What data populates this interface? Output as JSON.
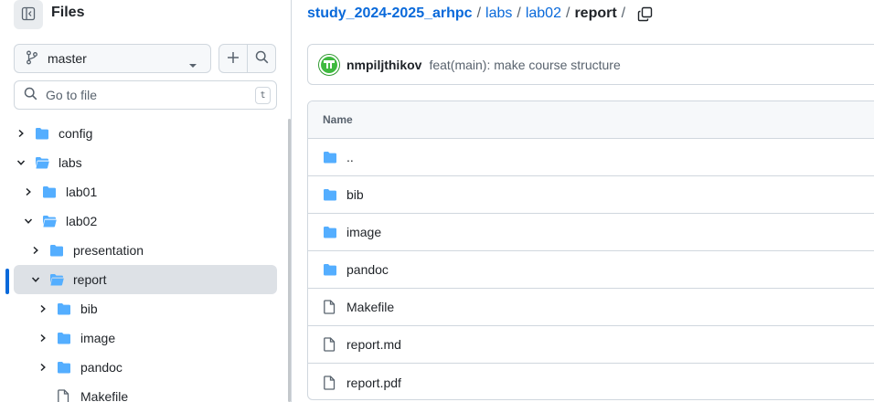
{
  "sidebar": {
    "title": "Files",
    "branch": "master",
    "goto_placeholder": "Go to file",
    "goto_shortcut": "t",
    "tree": [
      {
        "label": "config",
        "type": "folder",
        "expanded": false,
        "depth": 0
      },
      {
        "label": "labs",
        "type": "folder",
        "expanded": true,
        "depth": 0
      },
      {
        "label": "lab01",
        "type": "folder",
        "expanded": false,
        "depth": 1
      },
      {
        "label": "lab02",
        "type": "folder",
        "expanded": true,
        "depth": 1
      },
      {
        "label": "presentation",
        "type": "folder",
        "expanded": false,
        "depth": 2
      },
      {
        "label": "report",
        "type": "folder",
        "expanded": true,
        "depth": 2,
        "active": true
      },
      {
        "label": "bib",
        "type": "folder",
        "expanded": false,
        "depth": 3
      },
      {
        "label": "image",
        "type": "folder",
        "expanded": false,
        "depth": 3
      },
      {
        "label": "pandoc",
        "type": "folder",
        "expanded": false,
        "depth": 3
      },
      {
        "label": "Makefile",
        "type": "file",
        "depth": 3
      }
    ]
  },
  "breadcrumb": {
    "repo": "study_2024-2025_arhpc",
    "parts": [
      "labs",
      "lab02"
    ],
    "current": "report",
    "sep": "/"
  },
  "commit": {
    "author": "nmpiljthikov",
    "message": "feat(main): make course structure"
  },
  "file_table": {
    "header": "Name",
    "rows": [
      {
        "name": "..",
        "type": "folder"
      },
      {
        "name": "bib",
        "type": "folder"
      },
      {
        "name": "image",
        "type": "folder"
      },
      {
        "name": "pandoc",
        "type": "folder"
      },
      {
        "name": "Makefile",
        "type": "file"
      },
      {
        "name": "report.md",
        "type": "file"
      },
      {
        "name": "report.pdf",
        "type": "file"
      }
    ]
  },
  "colors": {
    "link": "#0969da",
    "folder": "#54aeff",
    "active_row": "#dde1e6",
    "border": "#d0d7de",
    "avatar": "#3fb93f"
  }
}
